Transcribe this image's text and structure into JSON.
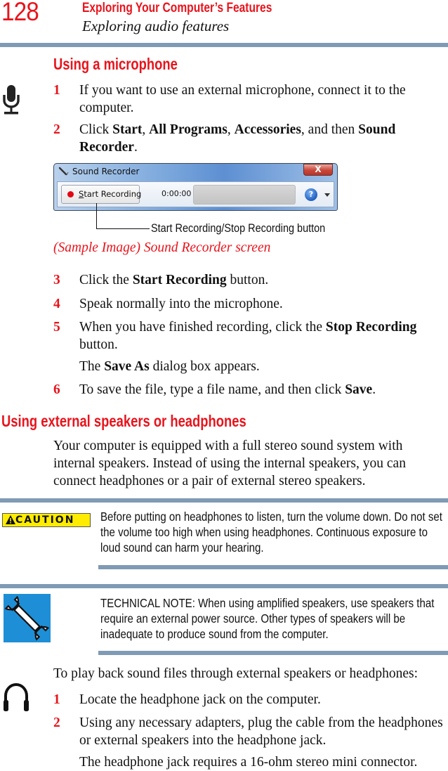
{
  "header": {
    "page_number": "128",
    "chapter_title": "Exploring Your Computer’s Features",
    "section_title": "Exploring audio features"
  },
  "colors": {
    "accent_red": "#e8141c",
    "rule_blue": "#7f9ab4",
    "caution_yellow": "#ffec00",
    "note_icon_blue": "#1e8fd6"
  },
  "microphone_section": {
    "heading": "Using a microphone",
    "icon": "microphone-icon",
    "steps": [
      {
        "num": "1",
        "parts": [
          {
            "t": "If you want to use an external microphone, connect it to the computer."
          }
        ]
      },
      {
        "num": "2",
        "parts": [
          {
            "t": "Click "
          },
          {
            "t": "Start",
            "b": true
          },
          {
            "t": ", "
          },
          {
            "t": "All Programs",
            "b": true
          },
          {
            "t": ", "
          },
          {
            "t": "Accessories",
            "b": true
          },
          {
            "t": ", and then "
          },
          {
            "t": "Sound Recorder",
            "b": true
          },
          {
            "t": "."
          }
        ]
      }
    ],
    "screenshot": {
      "window_title": "Sound Recorder",
      "close_label": "X",
      "record_button_label_underlined": "S",
      "record_button_label_rest": "tart Recording",
      "timer": "0:00:00",
      "help_label": "?",
      "callout": "Start Recording/Stop Recording button",
      "caption": "(Sample Image) Sound Recorder screen"
    },
    "steps_after": [
      {
        "num": "3",
        "parts": [
          {
            "t": "Click the "
          },
          {
            "t": "Start Recording",
            "b": true
          },
          {
            "t": " button."
          }
        ]
      },
      {
        "num": "4",
        "parts": [
          {
            "t": "Speak normally into the microphone."
          }
        ]
      },
      {
        "num": "5",
        "parts": [
          {
            "t": "When you have finished recording, click the "
          },
          {
            "t": "Stop Recording",
            "b": true
          },
          {
            "t": " button."
          }
        ]
      },
      {
        "num": "",
        "parts": [
          {
            "t": "The "
          },
          {
            "t": "Save As",
            "b": true
          },
          {
            "t": " dialog box appears."
          }
        ]
      },
      {
        "num": "6",
        "parts": [
          {
            "t": "To save the file, type a file name, and then click "
          },
          {
            "t": "Save",
            "b": true
          },
          {
            "t": "."
          }
        ]
      }
    ]
  },
  "speakers_section": {
    "heading": "Using external speakers or headphones",
    "intro": "Your computer is equipped with a full stereo sound system with internal speakers. Instead of using the internal speakers, you can connect headphones or a pair of external stereo speakers.",
    "caution": {
      "badge": "CAUTION",
      "icon": "warning-triangle-icon",
      "text": "Before putting on headphones to listen, turn the volume down. Do not set the volume too high when using headphones. Continuous exposure to loud sound can harm your hearing."
    },
    "technical_note": {
      "icon": "wrench-icon",
      "text": "TECHNICAL NOTE: When using amplified speakers, use speakers that require an external power source. Other types of speakers will be inadequate to produce sound from the computer."
    },
    "playback_intro": "To play back sound files through external speakers or headphones:",
    "icon": "headphones-icon",
    "steps": [
      {
        "num": "1",
        "parts": [
          {
            "t": "Locate the headphone jack on the computer."
          }
        ]
      },
      {
        "num": "2",
        "parts": [
          {
            "t": "Using any necessary adapters, plug the cable from the headphones or external speakers into the headphone jack."
          }
        ]
      },
      {
        "num": "",
        "parts": [
          {
            "t": "The headphone jack requires a 16-ohm stereo mini connector."
          }
        ]
      }
    ]
  }
}
